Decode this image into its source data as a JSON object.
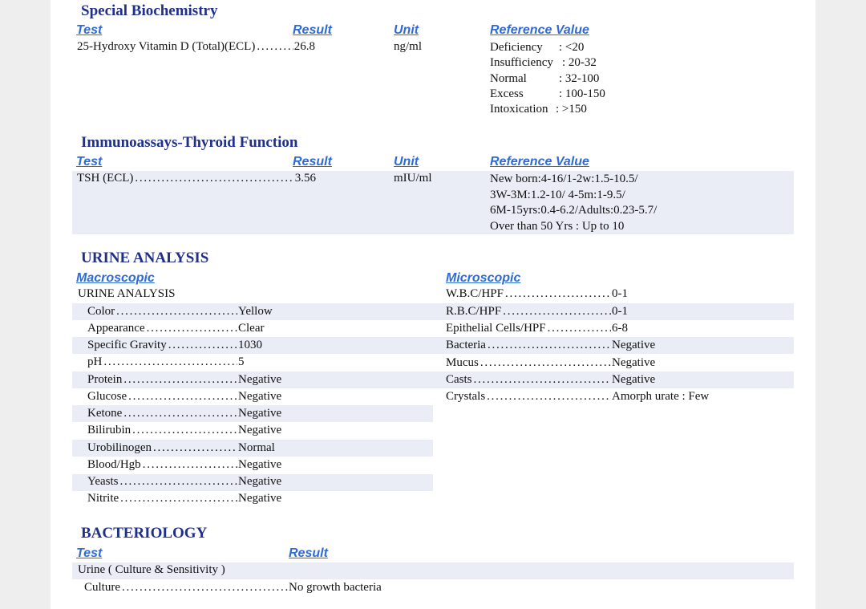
{
  "special": {
    "title": "Special Biochemistry",
    "hdr_test": "Test",
    "hdr_result": "Result",
    "hdr_unit": "Unit",
    "hdr_ref": "Reference Value",
    "test": "25-Hydroxy Vitamin D (Total)(ECL)",
    "result": "26.8",
    "unit": "ng/ml",
    "ref": [
      {
        "label": "Deficiency",
        "value": ": <20"
      },
      {
        "label": "Insufficiency",
        "value": ": 20-32"
      },
      {
        "label": "Normal",
        "value": ": 32-100"
      },
      {
        "label": "Excess",
        "value": ": 100-150"
      },
      {
        "label": "Intoxication",
        "value": ": >150"
      }
    ]
  },
  "thyroid": {
    "title": "Immunoassays-Thyroid Function",
    "hdr_test": "Test",
    "hdr_result": "Result",
    "hdr_unit": "Unit",
    "hdr_ref": "Reference Value",
    "test": "TSH (ECL)",
    "result": "3.56",
    "unit": "mIU/ml",
    "ref": [
      "New born:4-16/1-2w:1.5-10.5/",
      "3W-3M:1.2-10/ 4-5m:1-9.5/",
      "6M-15yrs:0.4-6.2/Adults:0.23-5.7/",
      "Over than 50 Yrs : Up to 10"
    ]
  },
  "urine": {
    "title": "URINE ANALYSIS",
    "hdr_macro": "Macroscopic",
    "hdr_micro": "Microscopic",
    "subtitle": "URINE ANALYSIS",
    "macro": [
      {
        "label": "Color",
        "value": "Yellow"
      },
      {
        "label": "Appearance",
        "value": "Clear"
      },
      {
        "label": "Specific Gravity",
        "value": "1030"
      },
      {
        "label": "pH",
        "value": "5"
      },
      {
        "label": "Protein",
        "value": "Negative"
      },
      {
        "label": "Glucose",
        "value": "Negative"
      },
      {
        "label": "Ketone",
        "value": "Negative"
      },
      {
        "label": "Bilirubin",
        "value": "Negative"
      },
      {
        "label": "Urobilinogen",
        "value": "Normal"
      },
      {
        "label": "Blood/Hgb",
        "value": "Negative"
      },
      {
        "label": "Yeasts",
        "value": "Negative"
      },
      {
        "label": "Nitrite",
        "value": "Negative"
      }
    ],
    "micro": [
      {
        "label": "W.B.C/HPF",
        "value": "0-1"
      },
      {
        "label": "R.B.C/HPF",
        "value": "0-1"
      },
      {
        "label": "Epithelial Cells/HPF",
        "value": "6-8"
      },
      {
        "label": "Bacteria",
        "value": "Negative"
      },
      {
        "label": "Mucus",
        "value": "Negative"
      },
      {
        "label": "Casts",
        "value": "Negative"
      },
      {
        "label": "Crystals",
        "value": "Amorph urate : Few"
      }
    ]
  },
  "bacteriology": {
    "title": "BACTERIOLOGY",
    "hdr_test": "Test",
    "hdr_result": "Result",
    "test": "Urine ( Culture & Sensitivity )",
    "row_label": "Culture",
    "row_value": "No growth bacteria"
  }
}
